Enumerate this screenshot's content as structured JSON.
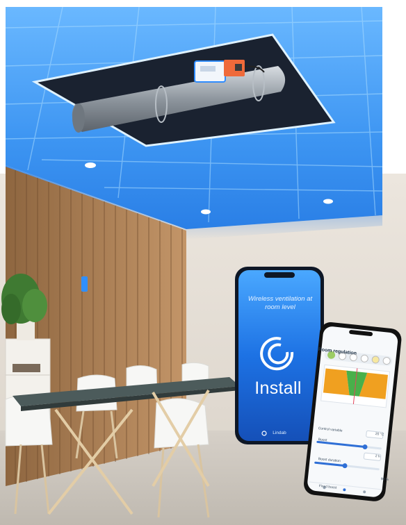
{
  "phone_blue": {
    "tagline": "Wireless ventilation at room level",
    "button_label": "Install",
    "brand": "Lindab"
  },
  "phone_app": {
    "title": "Room regulation",
    "control_variable_label": "Control variable",
    "control_variable_value": "20 °C",
    "boost_label": "Boost",
    "boost_duration_label": "Boost duration",
    "boost_duration_value": "2 h",
    "fixed_label": "Fixed boost",
    "fixed_value": "90 %"
  },
  "colors": {
    "ceiling_glow": "#2f8fff",
    "wall_wood": "#b98a5c",
    "table_top": "#4a5a5a",
    "phone_blue": "#1b6fe0",
    "chart_orange": "#f0a020",
    "chart_green": "#49b04a"
  },
  "icons": [
    "lindab-logo-icon",
    "plant-icon",
    "ceiling-light-icon",
    "sensor-icon"
  ]
}
